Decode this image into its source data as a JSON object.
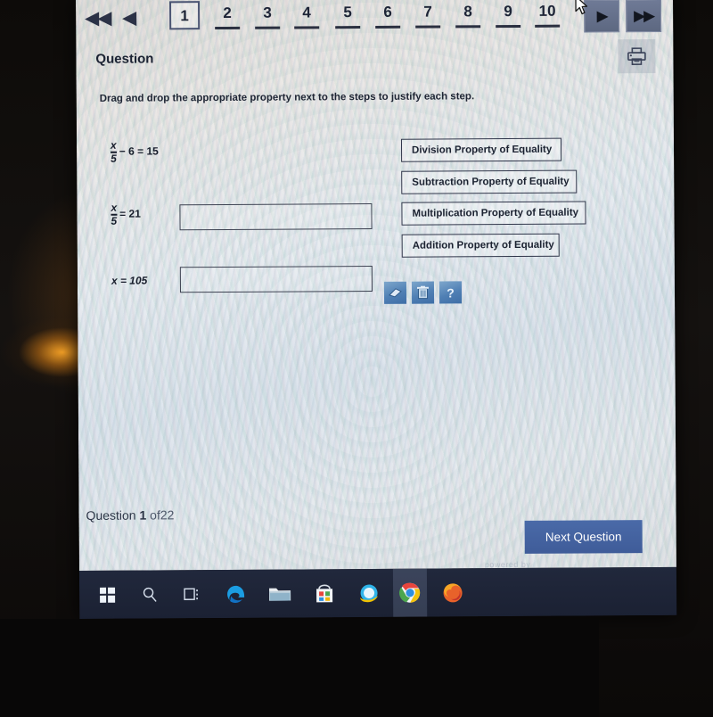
{
  "pagination": {
    "first_label": "◀◀",
    "prev_label": "◀",
    "next_label": "▶",
    "last_label": "▶▶",
    "current_page": "1",
    "pages": [
      "1",
      "2",
      "3",
      "4",
      "5",
      "6",
      "7",
      "8",
      "9",
      "10"
    ]
  },
  "header": {
    "title": "Question",
    "print_icon": "printer-icon"
  },
  "prompt": "Drag and drop the appropriate property next to the steps to justify each step.",
  "steps": [
    {
      "numerator": "x",
      "denominator": "5",
      "rest": "− 6 = 15",
      "has_dropbox": false
    },
    {
      "numerator": "x",
      "denominator": "5",
      "rest": "= 21",
      "has_dropbox": true
    },
    {
      "plain": "x = 105",
      "has_dropbox": true
    }
  ],
  "dropbox_value": "",
  "properties": [
    "Division Property of Equality",
    "Subtraction Property of Equality",
    "Multiplication Property of Equality",
    "Addition Property of Equality"
  ],
  "tools": [
    {
      "name": "eraser-icon",
      "glyph": "▱"
    },
    {
      "name": "trash-icon",
      "glyph": "🗑"
    },
    {
      "name": "help-icon",
      "glyph": "?"
    }
  ],
  "footer": {
    "question_label": "Question",
    "question_number": "1",
    "of_label": "of",
    "question_total": "22",
    "next_button": "Next Question",
    "powered_by": "powered by"
  },
  "taskbar": {
    "items": [
      {
        "name": "start-button",
        "label": "Start"
      },
      {
        "name": "search-icon",
        "label": "Search"
      },
      {
        "name": "task-view-icon",
        "label": "Task View"
      },
      {
        "name": "edge-icon",
        "label": "Microsoft Edge"
      },
      {
        "name": "file-explorer-icon",
        "label": "File Explorer"
      },
      {
        "name": "microsoft-store-icon",
        "label": "Microsoft Store"
      },
      {
        "name": "internet-explorer-icon",
        "label": "Internet Explorer"
      },
      {
        "name": "chrome-icon",
        "label": "Google Chrome"
      },
      {
        "name": "firefox-icon",
        "label": "Mozilla Firefox"
      }
    ]
  },
  "colors": {
    "accent_blue": "#3f5c99",
    "tool_blue": "#4f7fb4",
    "nav_button": "#6f7a96",
    "taskbar": "#1b2133"
  }
}
